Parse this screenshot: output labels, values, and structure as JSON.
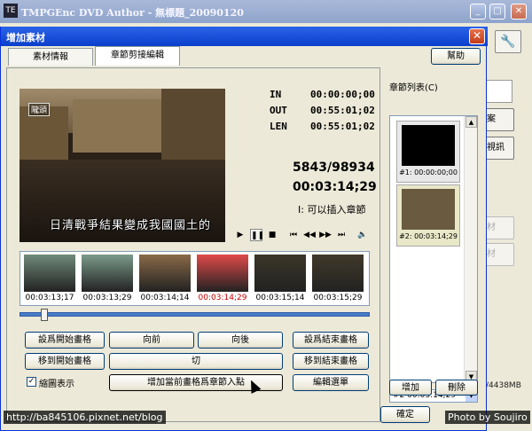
{
  "main_window": {
    "title": "TMPGEnc DVD Author - 無標題_20090120",
    "app_icon": "TE",
    "icons": {
      "minimize": "minimize-icon",
      "maximize": "maximize-icon",
      "close": "close-icon",
      "tool": "wrench-icon"
    },
    "side_buttons": [
      {
        "label": "案",
        "enabled": true
      },
      {
        "label": "視訊",
        "enabled": true
      },
      {
        "label": "材",
        "enabled": false
      },
      {
        "label": "材",
        "enabled": false
      }
    ],
    "size_readout": "/4438MB"
  },
  "dialog": {
    "title": "增加素材",
    "tabs": [
      {
        "label": "素材情報",
        "active": false
      },
      {
        "label": "章節剪接編輯",
        "active": true
      }
    ],
    "help_label": "幫助",
    "timecodes": [
      {
        "label": "IN",
        "value": "00:00:00;00"
      },
      {
        "label": "OUT",
        "value": "00:55:01;02"
      },
      {
        "label": "LEN",
        "value": "00:55:01;02"
      }
    ],
    "frame_count": "5843/98934",
    "current_timecode": "00:03:14;29",
    "insert_note": "I: 可以插入章節",
    "video": {
      "subtitle": "日清戰爭結果變成我國國土的",
      "tag": "隴頭"
    },
    "player_icons": [
      "play-icon",
      "pause-icon",
      "stop-icon",
      "prev-chapter-icon",
      "step-back-icon",
      "step-forward-icon",
      "next-chapter-icon",
      "volume-icon"
    ],
    "thumbnails": [
      {
        "tc": "00:03:13;17",
        "selected": false,
        "color": "#6f8a7a"
      },
      {
        "tc": "00:03:13;29",
        "selected": false,
        "color": "#7b9a8a"
      },
      {
        "tc": "00:03:14;14",
        "selected": false,
        "color": "#8a6a48"
      },
      {
        "tc": "00:03:14;29",
        "selected": true,
        "color": "#e04a4a"
      },
      {
        "tc": "00:03:15;14",
        "selected": false,
        "color": "#3a3628"
      },
      {
        "tc": "00:03:15;29",
        "selected": false,
        "color": "#403a2a"
      }
    ],
    "slider_position": 0.06,
    "buttons": {
      "set_start": "設爲開始畫格",
      "forward": "向前",
      "backward": "向後",
      "set_end": "設爲結束畫格",
      "goto_start": "移到開始畫格",
      "cut": "切",
      "goto_end": "移到結束畫格",
      "add_chapter": "增加當前畫格爲章節入點",
      "edit_menu": "編輯選單"
    },
    "thumb_display": {
      "label": "縮圖表示",
      "checked": true
    },
    "chapter_list": {
      "label": "章節列表(C)",
      "items": [
        {
          "caption": "#1: 00:00:00;00",
          "color": "#000000",
          "selected": false
        },
        {
          "caption": "#2: 00:03:14;29",
          "color": "#6a5a40",
          "selected": true
        }
      ],
      "selected_value": "#2  00:03:14;29",
      "add_label": "增加",
      "delete_label": "刪除"
    },
    "ok_label": "確定"
  },
  "watermarks": {
    "left": "http://ba845106.pixnet.net/blog",
    "right": "Photo by Soujiro"
  }
}
